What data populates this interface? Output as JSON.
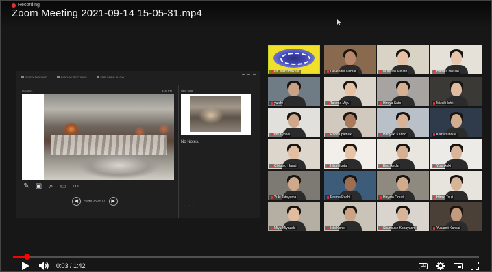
{
  "video": {
    "title": "Zoom Meeting 2021-09-14 15-05-31.mp4",
    "recording_label": "Recording",
    "current_time": "0:03",
    "duration": "1:42",
    "time_display": "0:03 / 1:42",
    "progress_fraction": 0.029
  },
  "presentation": {
    "toolbar": [
      "SHOW TASKBAR",
      "DISPLAY SETTINGS",
      "END SLIDE SHOW"
    ],
    "timer": "00:00:01",
    "clock": "3:05 PM",
    "next_slide_label": "Next Slide",
    "notes": "No Notes.",
    "slide_counter": "Slide 25 of 77"
  },
  "participants": [
    {
      "name": "Dr. Nazri Hakkar",
      "row": 0,
      "col": 0,
      "tone": "#c79b7a",
      "bg": "#f0e02a",
      "deco": true,
      "active": true
    },
    {
      "name": "Devendra Kumar",
      "row": 0,
      "col": 1,
      "tone": "#b9876a",
      "bg": "#8a6a4e"
    },
    {
      "name": "Mutsuko Minato",
      "row": 0,
      "col": 2,
      "tone": "#e7c2a6",
      "bg": "#d9d3c6"
    },
    {
      "name": "Haruka Nozaki",
      "row": 0,
      "col": 3,
      "tone": "#e9c7ad",
      "bg": "#e6e1d8"
    },
    {
      "name": "yuichi",
      "row": 1,
      "col": 0,
      "tone": "#caa286",
      "bg": "#6f7c86"
    },
    {
      "name": "Takeda Miyu",
      "row": 1,
      "col": 1,
      "tone": "#e6c1a2",
      "bg": "#dcd5cb"
    },
    {
      "name": "Hiroya Sato",
      "row": 1,
      "col": 2,
      "tone": "#d7b092",
      "bg": "#a6a3a0"
    },
    {
      "name": "Mizuki Ishii",
      "row": 1,
      "col": 3,
      "tone": "#dfbc9f",
      "bg": "#3a3936"
    },
    {
      "name": "Itoi Kyohei",
      "row": 2,
      "col": 0,
      "tone": "#cfa88b",
      "bg": "#e2e0dc"
    },
    {
      "name": "Rohita pathak",
      "row": 2,
      "col": 1,
      "tone": "#a97a5c",
      "bg": "#d1c9be"
    },
    {
      "name": "Hiroyuki Kanno",
      "row": 2,
      "col": 2,
      "tone": "#d8b396",
      "bg": "#b9c0c7"
    },
    {
      "name": "Kazuki Inoue",
      "row": 2,
      "col": 3,
      "tone": "#d2ad90",
      "bg": "#2f3b4a"
    },
    {
      "name": "Chikayo Hanai",
      "row": 3,
      "col": 0,
      "tone": "#e2bfa2",
      "bg": "#dcd6cc"
    },
    {
      "name": "Hitori Ikuta",
      "row": 3,
      "col": 1,
      "tone": "#e5c4a8",
      "bg": "#f2efea"
    },
    {
      "name": "Eiru Ikeda",
      "row": 3,
      "col": 2,
      "tone": "#d6b092",
      "bg": "#e9e6e0"
    },
    {
      "name": "Yuta Aoki",
      "row": 3,
      "col": 3,
      "tone": "#d9b699",
      "bg": "#ecebe7"
    },
    {
      "name": "Yuki Tateyama",
      "row": 4,
      "col": 0,
      "tone": "#cfa98c",
      "bg": "#7d7a73"
    },
    {
      "name": "Prema Rachi",
      "row": 4,
      "col": 1,
      "tone": "#9c6e52",
      "bg": "#3d5c7a"
    },
    {
      "name": "Hayato Onuki",
      "row": 4,
      "col": 2,
      "tone": "#d2ab8c",
      "bg": "#8f8a80"
    },
    {
      "name": "Hiroki Tsuji",
      "row": 4,
      "col": 3,
      "tone": "#d7b497",
      "bg": "#e7e4de"
    },
    {
      "name": "Miyu Miyazaki",
      "row": 5,
      "col": 0,
      "tone": "#e0bd9f",
      "bg": "#b5aea3"
    },
    {
      "name": "Ichi Kohei",
      "row": 5,
      "col": 1,
      "tone": "#cba385",
      "bg": "#c9c3b8"
    },
    {
      "name": "Shunsuke Kobayashi",
      "row": 5,
      "col": 2,
      "tone": "#d8b598",
      "bg": "#d9d5ce"
    },
    {
      "name": "Yusamit Kansai",
      "row": 5,
      "col": 3,
      "tone": "#c39a7d",
      "bg": "#4a4038"
    }
  ],
  "controls": {
    "play_icon": "play-icon",
    "volume_icon": "volume-icon",
    "cc_label": "CC",
    "settings_icon": "gear-icon",
    "miniplayer_icon": "miniplayer-icon",
    "fullscreen_icon": "fullscreen-icon"
  },
  "colors": {
    "progress": "#ff0000",
    "active_speaker": "#c7d82a"
  }
}
